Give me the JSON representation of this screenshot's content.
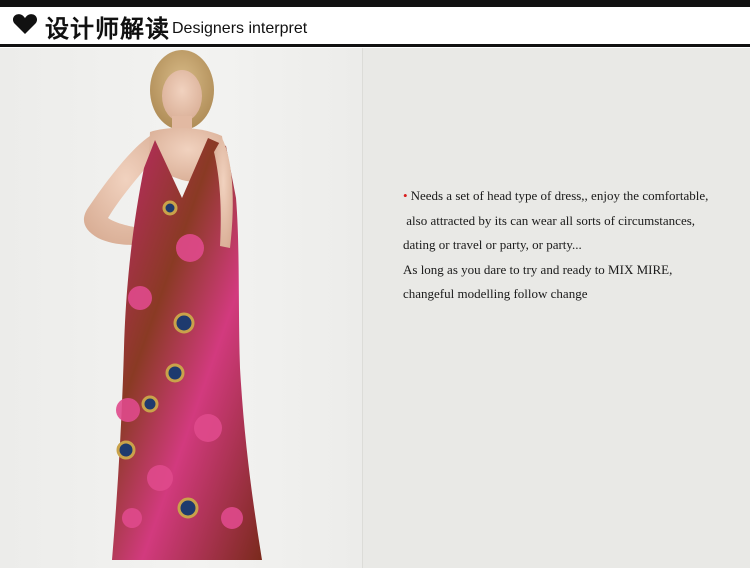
{
  "header": {
    "title_cn": "设计师解读",
    "title_en": "Designers interpret",
    "icon": "heart-icon"
  },
  "photo": {
    "subject": "model-in-maxi-dress-image"
  },
  "description": {
    "bullet": "•",
    "lines": [
      "Needs a set of head type of dress,, enjoy the comfortable,",
      " also attracted by its can wear all sorts of circumstances,",
      "dating or travel or party, or party...",
      "As long as you dare to try and ready to MIX MIRE,",
      "changeful modelling follow change"
    ]
  },
  "colors": {
    "bullet": "#d91e1e",
    "rule": "#111111",
    "text_panel_bg": "#e9e9e6"
  }
}
